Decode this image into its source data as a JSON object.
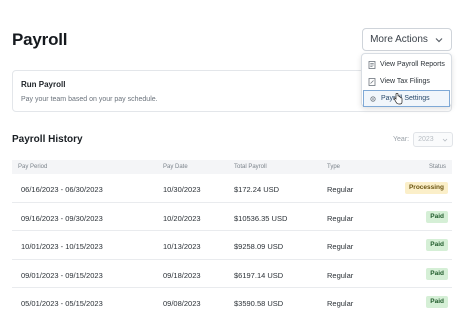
{
  "page": {
    "title": "Payroll"
  },
  "actions": {
    "more_label": "More Actions",
    "menu": [
      {
        "label": "View Payroll Reports",
        "icon": "report-icon"
      },
      {
        "label": "View Tax Filings",
        "icon": "document-icon"
      },
      {
        "label": "Payroll Settings",
        "icon": "gear-icon"
      }
    ]
  },
  "run_card": {
    "title": "Run Payroll",
    "description": "Pay your team based on your pay schedule."
  },
  "history": {
    "title": "Payroll History",
    "year_label": "Year:",
    "year_value": "2023",
    "columns": [
      "Pay Period",
      "Pay Date",
      "Total Payroll",
      "Type",
      "Status"
    ],
    "rows": [
      {
        "period": "06/16/2023 - 06/30/2023",
        "pay_date": "10/30/2023",
        "total": "$172.24 USD",
        "type": "Regular",
        "status": "Processing"
      },
      {
        "period": "09/16/2023 - 09/30/2023",
        "pay_date": "10/20/2023",
        "total": "$10536.35 USD",
        "type": "Regular",
        "status": "Paid"
      },
      {
        "period": "10/01/2023 - 10/15/2023",
        "pay_date": "10/13/2023",
        "total": "$9258.09 USD",
        "type": "Regular",
        "status": "Paid"
      },
      {
        "period": "09/01/2023 - 09/15/2023",
        "pay_date": "09/18/2023",
        "total": "$6197.14 USD",
        "type": "Regular",
        "status": "Paid"
      },
      {
        "period": "05/01/2023 - 05/15/2023",
        "pay_date": "09/08/2023",
        "total": "$3590.58 USD",
        "type": "Regular",
        "status": "Paid"
      }
    ]
  },
  "colors": {
    "processing_bg": "#fbefc9",
    "paid_bg": "#d5efd6",
    "accent": "#7fa9d6"
  }
}
